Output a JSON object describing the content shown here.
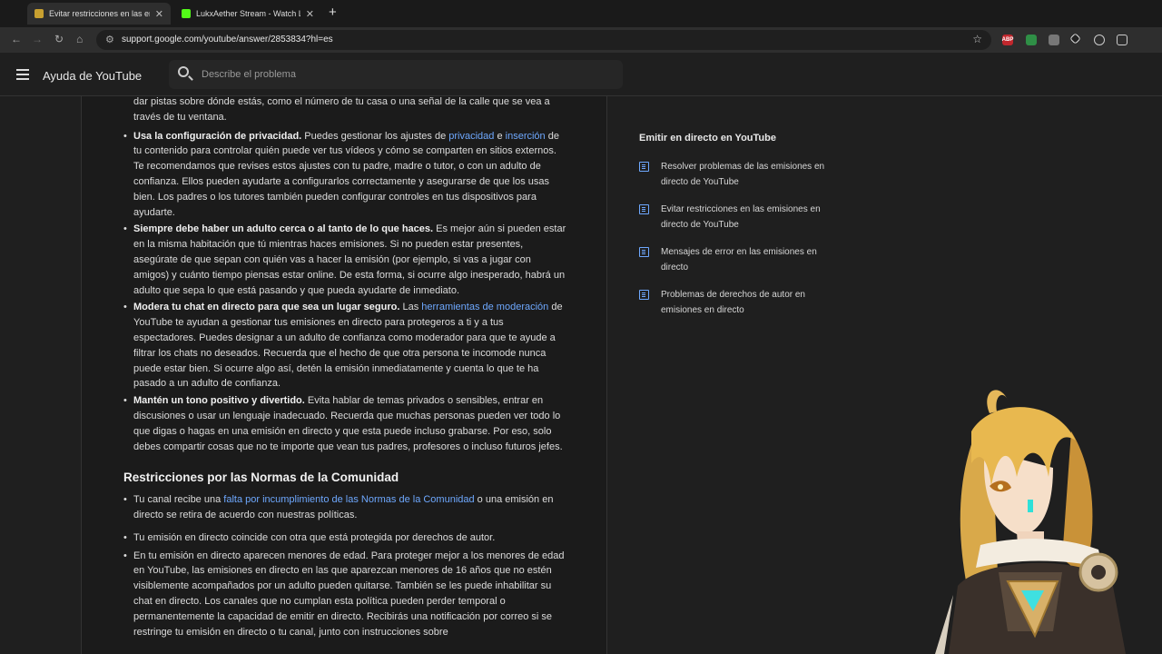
{
  "browser": {
    "tabs": [
      {
        "title": "Evitar restricciones en las emisio…",
        "active": true
      },
      {
        "title": "LukxAether Stream - Watch Liv…",
        "active": false
      }
    ],
    "url": "support.google.com/youtube/answer/2853834?hl=es"
  },
  "header": {
    "site_title": "Ayuda de YouTube",
    "search_placeholder": "Describe el problema"
  },
  "article": {
    "p0": "dar pistas sobre dónde estás, como el número de tu casa o una señal de la calle que se vea a través de tu ventana.",
    "b1": {
      "bold": "Usa la configuración de privacidad.",
      "t1": " Puedes gestionar los ajustes de ",
      "l1": "privacidad",
      "t2": " e ",
      "l2": "inserción",
      "t3": " de tu contenido para controlar quién puede ver tus vídeos y cómo se comparten en sitios externos. Te recomendamos que revises estos ajustes con tu padre, madre o tutor, o con un adulto de confianza. Ellos pueden ayudarte a configurarlos correctamente y asegurarse de que los usas bien. Los padres o los tutores también pueden configurar controles en tus dispositivos para ayudarte."
    },
    "b2": {
      "bold": "Siempre debe haber un adulto cerca o al tanto de lo que haces.",
      "text": " Es mejor aún si pueden estar en la misma habitación que tú mientras haces emisiones. Si no pueden estar presentes, asegúrate de que sepan con quién vas a hacer la emisión (por ejemplo, si vas a jugar con amigos) y cuánto tiempo piensas estar online. De esta forma, si ocurre algo inesperado, habrá un adulto que sepa lo que está pasando y que pueda ayudarte de inmediato."
    },
    "b3": {
      "bold": "Modera tu chat en directo para que sea un lugar seguro.",
      "t1": " Las ",
      "l1": "herramientas de moderación",
      "t2": " de YouTube te ayudan a gestionar tus emisiones en directo para protegeros a ti y a tus espectadores. Puedes designar a un adulto de confianza como moderador para que te ayude a filtrar los chats no deseados. Recuerda que el hecho de que otra persona te incomode nunca puede estar bien. Si ocurre algo así, detén la emisión inmediatamente y cuenta lo que te ha pasado a un adulto de confianza."
    },
    "b4": {
      "bold": "Mantén un tono positivo y divertido.",
      "text": " Evita hablar de temas privados o sensibles, entrar en discusiones o usar un lenguaje inadecuado. Recuerda que muchas personas pueden ver todo lo que digas o hagas en una emisión en directo y que esta puede incluso grabarse. Por eso, solo debes compartir cosas que no te importe que vean tus padres, profesores o incluso futuros jefes."
    },
    "section_heading": "Restricciones por las Normas de la Comunidad",
    "c1": {
      "t1": "Tu canal recibe una ",
      "l1": "falta por incumplimiento de las Normas de la Comunidad",
      "t2": " o una emisión en directo se retira de acuerdo con nuestras políticas."
    },
    "c2": "Tu emisión en directo coincide con otra que está protegida por derechos de autor.",
    "c3": "En tu emisión en directo aparecen menores de edad. Para proteger mejor a los menores de edad en YouTube, las emisiones en directo en las que aparezcan menores de 16 años que no estén visiblemente acompañados por un adulto pueden quitarse. También se les puede inhabilitar su chat en directo. Los canales que no cumplan esta política pueden perder temporal o permanentemente la capacidad de emitir en directo. Recibirás una notificación por correo si se restringe tu emisión en directo o tu canal, junto con instrucciones sobre"
  },
  "sidenav": {
    "heading": "Emitir en directo en YouTube",
    "items": [
      "Resolver problemas de las emisiones en directo de YouTube",
      "Evitar restricciones en las emisiones en directo de YouTube",
      "Mensajes de error en las emisiones en directo",
      "Problemas de derechos de autor en emisiones en directo"
    ]
  },
  "colors": {
    "link": "#6ea8fe",
    "background": "#1f1f1f"
  },
  "icons": [
    "menu-icon",
    "search-icon",
    "document-icon",
    "star-icon",
    "back-icon",
    "forward-icon",
    "reload-icon",
    "home-icon",
    "tune-icon"
  ]
}
